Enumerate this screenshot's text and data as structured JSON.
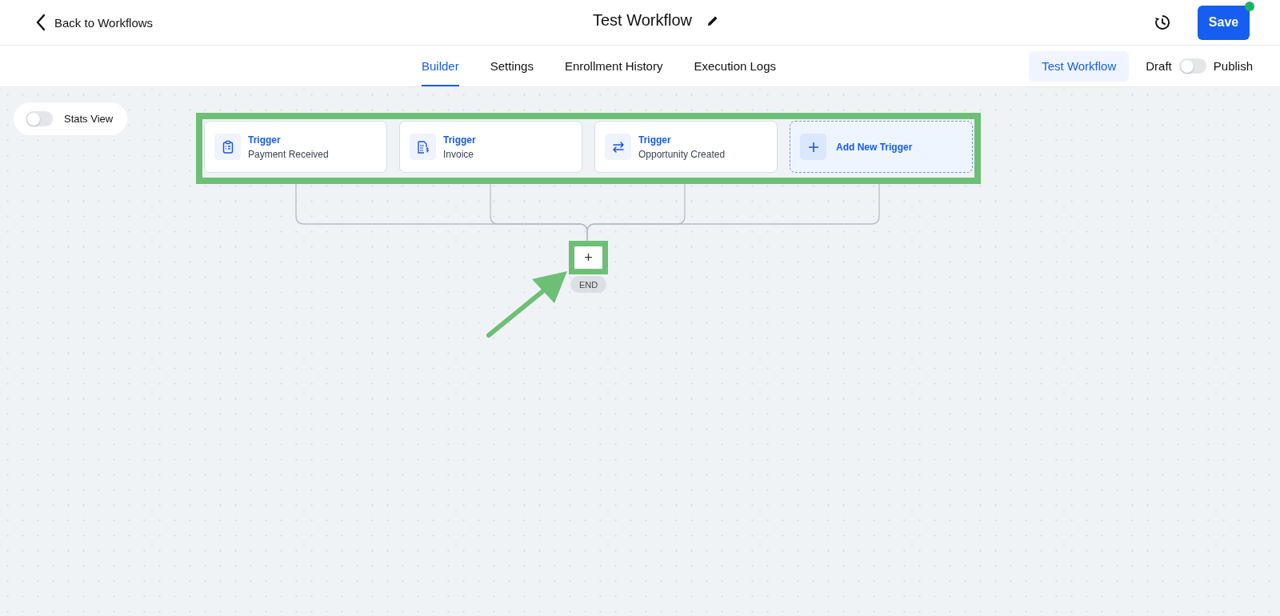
{
  "header": {
    "back_label": "Back to Workflows",
    "title": "Test Workflow",
    "save_label": "Save"
  },
  "tabs": [
    {
      "label": "Builder",
      "selected": true
    },
    {
      "label": "Settings",
      "selected": false
    },
    {
      "label": "Enrollment History",
      "selected": false
    },
    {
      "label": "Execution Logs",
      "selected": false
    }
  ],
  "test_button": "Test Workflow",
  "publish": {
    "off_label": "Draft",
    "on_label": "Publish",
    "on": false
  },
  "stats_view": {
    "label": "Stats View",
    "on": false
  },
  "triggers": [
    {
      "kind": "trigger",
      "title": "Trigger",
      "name": "Payment Received"
    },
    {
      "kind": "trigger",
      "title": "Trigger",
      "name": "Invoice"
    },
    {
      "kind": "trigger",
      "title": "Trigger",
      "name": "Opportunity Created"
    },
    {
      "kind": "add",
      "label": "Add New Trigger"
    }
  ],
  "add_step": "+",
  "end_label": "END"
}
